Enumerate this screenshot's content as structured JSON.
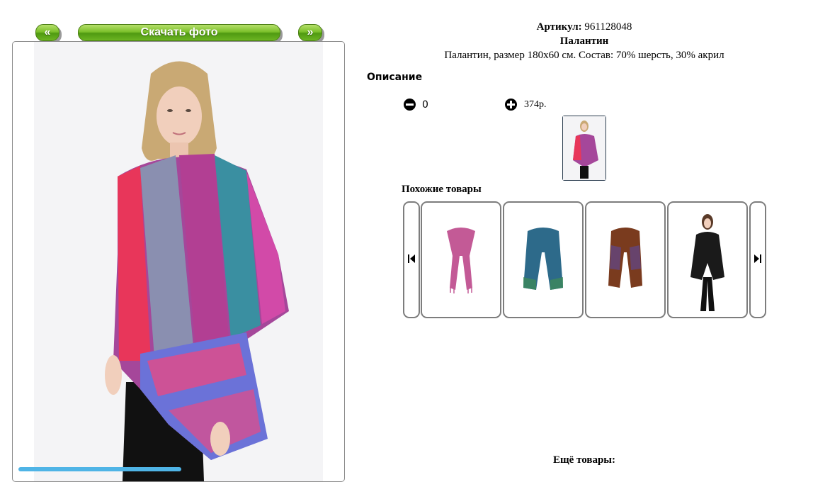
{
  "nav": {
    "prev_label": "«",
    "download_label": "Скачать фото",
    "next_label": "»"
  },
  "product": {
    "article_label": "Артикул:",
    "article_value": "961128048",
    "title": "Палантин",
    "description": "Палантин, размер 180х60 см. Состав: 70% шерсть, 30% акрил",
    "description_heading": "Описание"
  },
  "cart": {
    "quantity": "0",
    "price": "374р."
  },
  "similar": {
    "heading": "Похожие товары",
    "items": [
      {
        "name": "pink-scarf",
        "color": "#c35a96"
      },
      {
        "name": "blue-green-scarf",
        "color": "#2d6a8a"
      },
      {
        "name": "brown-paisley-scarf",
        "color": "#7a3b1e"
      },
      {
        "name": "black-cardigan",
        "color": "#1a1a1a"
      }
    ]
  },
  "more_heading": "Ещё товары:",
  "colors": {
    "button_green": "#6db522",
    "frame_border": "#8a8a8a",
    "strip_blue": "#4fb4e6"
  }
}
